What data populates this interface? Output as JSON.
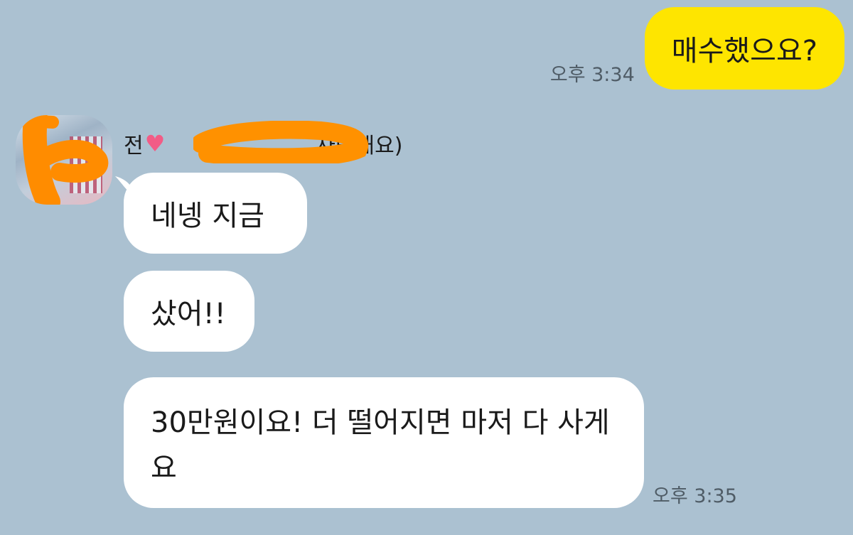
{
  "messages": {
    "outgoing": {
      "text": "매수했으요?",
      "time": "오후 3:34"
    },
    "incoming": {
      "sender": {
        "name_start": "전",
        "name_end": "사랑해요)",
        "heart_icon": "heart-icon"
      },
      "bubbles": [
        {
          "text": "네넹 지금"
        },
        {
          "text": "샀어!!"
        },
        {
          "text": "30만원이요! 더 떨어지면 마저 다 사게요"
        }
      ],
      "time": "오후 3:35"
    }
  },
  "colors": {
    "background": "#abc1d1",
    "outgoing_bubble": "#fee500",
    "incoming_bubble": "#ffffff",
    "redaction": "#ff9100"
  }
}
